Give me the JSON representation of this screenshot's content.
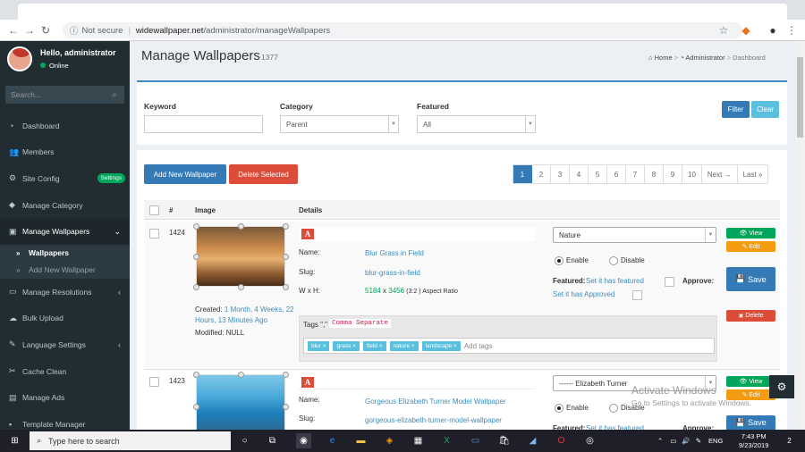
{
  "browser": {
    "security": "Not secure",
    "host": "widewallpaper.net",
    "path": "/administrator/manageWallpapers"
  },
  "sidebar": {
    "user_name": "Hello, administrator",
    "status": "Online",
    "search_placeholder": "Search...",
    "items": [
      {
        "label": "Dashboard",
        "icon": "dashboard-icon"
      },
      {
        "label": "Members",
        "icon": "users-icon"
      },
      {
        "label": "Site Config",
        "icon": "cogs-icon",
        "badge": "Settings"
      },
      {
        "label": "Manage Category",
        "icon": "tag-icon"
      },
      {
        "label": "Manage Wallpapers",
        "icon": "camera-icon"
      },
      {
        "label": "Manage Resolutions",
        "icon": "desktop-icon"
      },
      {
        "label": "Bulk Upload",
        "icon": "cloud-upload-icon"
      },
      {
        "label": "Language Settings",
        "icon": "language-icon"
      },
      {
        "label": "Cache Clean",
        "icon": "broom-icon"
      },
      {
        "label": "Manage Ads",
        "icon": "ad-icon"
      },
      {
        "label": "Template Manager",
        "icon": "file-icon"
      }
    ],
    "subitems": [
      {
        "label": "Wallpapers"
      },
      {
        "label": "Add New Wallpaper"
      }
    ]
  },
  "page": {
    "title": "Manage Wallpapers",
    "count": "1377",
    "breadcrumb": [
      "Home",
      "Administrator",
      "Dashboard"
    ]
  },
  "filter": {
    "keyword_label": "Keyword",
    "keyword_value": "",
    "category_label": "Category",
    "category_value": "Parent",
    "featured_label": "Featured",
    "featured_value": "All",
    "filter_btn": "Filter",
    "clear_btn": "Clear"
  },
  "actions": {
    "add_new": "Add New Wallpaper",
    "delete_selected": "Delete Selected"
  },
  "pagination": [
    "1",
    "2",
    "3",
    "4",
    "5",
    "6",
    "7",
    "8",
    "9",
    "10",
    "Next →",
    "Last »"
  ],
  "table": {
    "headers": [
      "#",
      "Image",
      "Details"
    ],
    "rows": [
      {
        "id": "1424",
        "name_label": "Name:",
        "name": "Blur Grass in Field",
        "slug_label": "Slug:",
        "slug": "blur-grass-in-field",
        "wxh_label": "W x H:",
        "width": "5184",
        "x": "x",
        "height": "3456",
        "ratio": "(3:2 ) Aspect Ratio",
        "created_label": "Created:",
        "created": "1 Month, 4 Weeks, 22 Hours, 13 Minutes Ago",
        "modified_label": "Modified:",
        "modified": "NULL",
        "tags_label": "Tags \",\"",
        "tags_hint": "Comma Separate",
        "tags": [
          "blur",
          "grass",
          "field",
          "nature",
          "landscape"
        ],
        "add_tags": "Add tags",
        "category": "Nature",
        "enable": "Enable",
        "disable": "Disable",
        "featured_label": "Featured:",
        "set_featured": "Set it has featured",
        "approve_label": "Approve:",
        "set_approved": "Set it has Approved",
        "view_btn": "View",
        "edit_btn": "Edit",
        "save_btn": "Save",
        "delete_btn": "Delete"
      },
      {
        "id": "1423",
        "name_label": "Name:",
        "name": "Gorgeous Elizabeth Turner Model Wallpaper",
        "slug_label": "Slug:",
        "slug": "gorgeous-elizabeth-turner-model-wallpaper",
        "category": "------ Elizabeth Turner",
        "enable": "Enable",
        "disable": "Disable",
        "featured_label": "Featured:",
        "set_featured": "Set it has featured",
        "approve_label": "Approve:",
        "view_btn": "View",
        "edit_btn": "Edit",
        "save_btn": "Save"
      }
    ]
  },
  "watermark": {
    "title": "Activate Windows",
    "subtitle": "Go to Settings to activate Windows."
  },
  "taskbar": {
    "search": "Type here to search",
    "lang": "ENG",
    "time": "7:43 PM",
    "date": "9/23/2019",
    "notifications": "2"
  },
  "colors": {
    "sidebar": "#222d32",
    "primary": "#337ab7",
    "danger": "#dd4b39",
    "success": "#00a65a",
    "warning": "#f39c12",
    "info": "#5bc0de"
  }
}
